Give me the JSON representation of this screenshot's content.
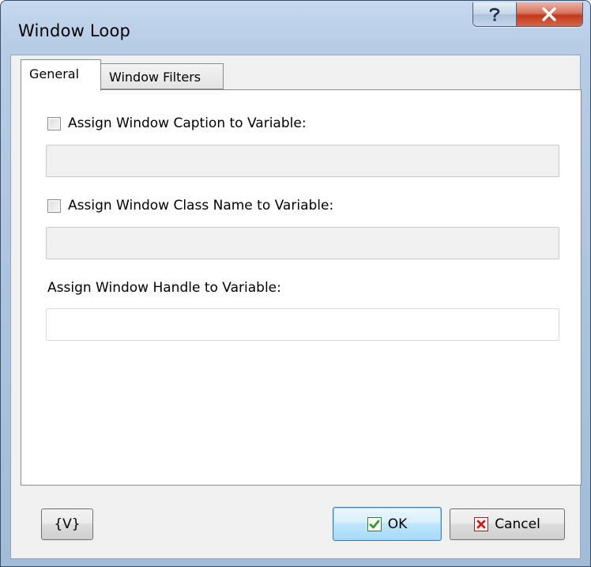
{
  "window": {
    "title": "Window Loop",
    "help_icon": "question-mark-icon",
    "close_icon": "close-x-icon"
  },
  "tabs": [
    {
      "label": "General",
      "active": true
    },
    {
      "label": "Window Filters",
      "active": false
    }
  ],
  "general": {
    "caption_checkbox": {
      "label": "Assign Window Caption to Variable:",
      "checked": false
    },
    "caption_field": {
      "value": "",
      "enabled": false
    },
    "class_checkbox": {
      "label": "Assign Window Class Name to Variable:",
      "checked": false
    },
    "class_field": {
      "value": "",
      "enabled": false
    },
    "handle_label": "Assign Window Handle to Variable:",
    "handle_field": {
      "value": "",
      "enabled": true
    }
  },
  "buttons": {
    "variables_label": "{V}",
    "ok_label": "OK",
    "ok_icon": "green-check-icon",
    "cancel_label": "Cancel",
    "cancel_icon": "red-x-icon"
  },
  "colors": {
    "title_bar": "#b7cde6",
    "close_button": "#c2391c",
    "ok_check": "#2e9b2e",
    "cancel_x": "#d11a1a"
  }
}
